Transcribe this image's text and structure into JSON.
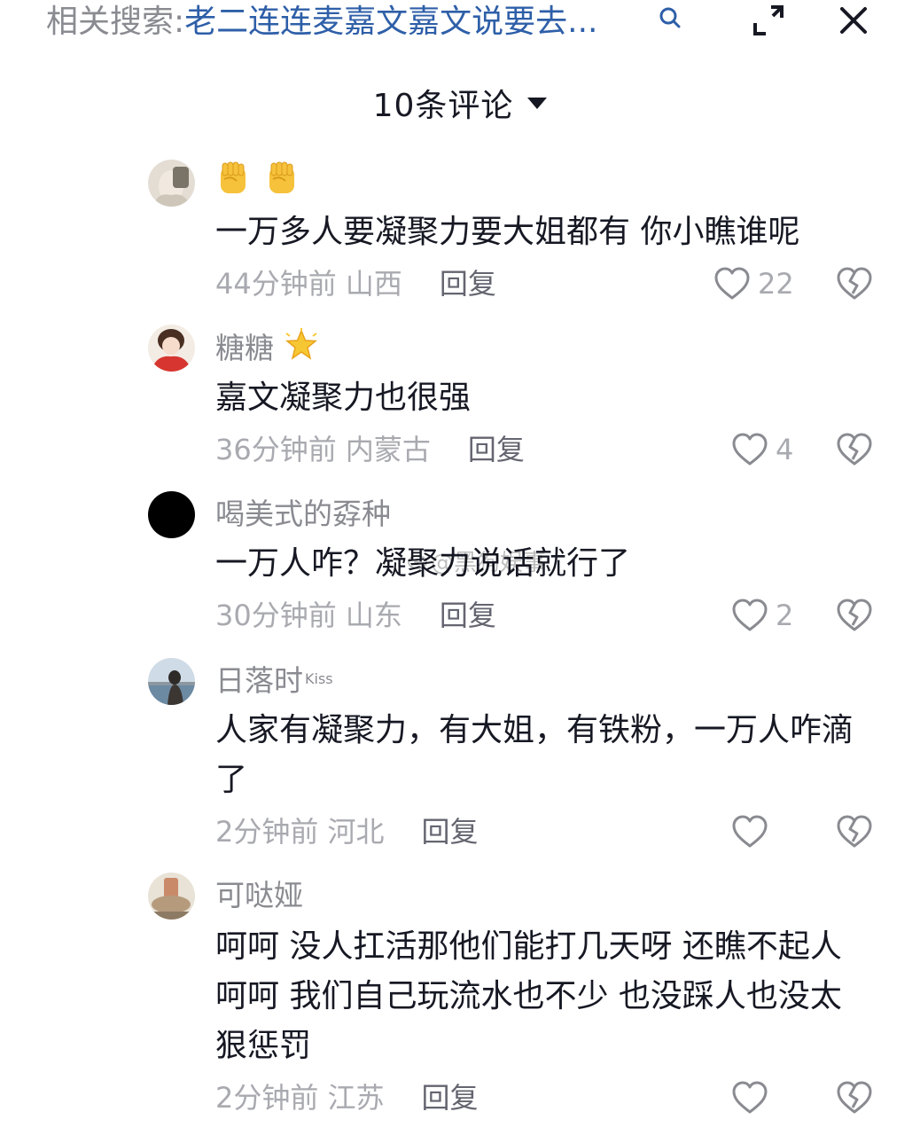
{
  "search": {
    "prefix": "相关搜索:",
    "query": "老二连连麦嘉文嘉文说要去..."
  },
  "header": {
    "title": "10条评论"
  },
  "watermark": {
    "text": "@黑狗娱事"
  },
  "comments": [
    {
      "username": "",
      "username_emoji": [
        "raised-fist",
        "raised-fist"
      ],
      "text": "一万多人要凝聚力要大姐都有 你小瞧谁呢",
      "time_location": "44分钟前 山西",
      "reply_label": "回复",
      "likes": "22"
    },
    {
      "username": "糖糖",
      "username_emoji": [
        "glowing-star"
      ],
      "text": "嘉文凝聚力也很强",
      "time_location": "36分钟前 内蒙古",
      "reply_label": "回复",
      "likes": "4"
    },
    {
      "username": "喝美式的孬种",
      "text": "一万人咋？凝聚力说话就行了",
      "time_location": "30分钟前 山东",
      "reply_label": "回复",
      "likes": "2"
    },
    {
      "username": "日落时",
      "username_sup": "Kiss",
      "text": "人家有凝聚力，有大姐，有铁粉，一万人咋滴了",
      "time_location": "2分钟前 河北",
      "reply_label": "回复",
      "likes": ""
    },
    {
      "username": "可哒娅",
      "text": "呵呵 没人扛活那他们能打几天呀 还瞧不起人 呵呵 我们自己玩流水也不少 也没踩人也没太狠惩罚",
      "time_location": "2分钟前 江苏",
      "reply_label": "回复",
      "likes": ""
    }
  ],
  "colors": {
    "text_primary": "#161823",
    "text_secondary": "#8a8b91",
    "text_meta": "#a9aab0",
    "query_link": "#2e5fa8",
    "icon": "#8a8b91"
  }
}
